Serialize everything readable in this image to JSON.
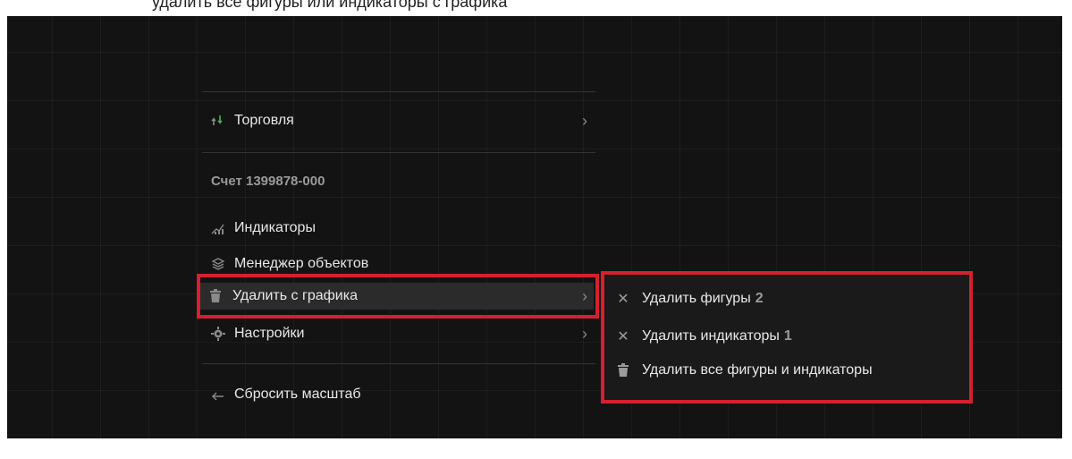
{
  "header_caption": "удалить все фигуры или индикаторы с графика",
  "menu": {
    "trade": {
      "label": "Торговля",
      "chevron": "›",
      "icon": "trade-arrows-icon"
    },
    "account_title": "Счет 1399878-000",
    "indicators": {
      "label": "Индикаторы",
      "icon": "indicators-chart-icon"
    },
    "object_manager": {
      "label": "Менеджер объектов",
      "icon": "layers-icon"
    },
    "remove_from_chart": {
      "label": "Удалить с графика",
      "chevron": "›",
      "icon": "trash-icon"
    },
    "settings": {
      "label": "Настройки",
      "chevron": "›",
      "icon": "gear-icon"
    },
    "reset_scale": {
      "label": "Сбросить масштаб",
      "icon": "back-arrow-icon"
    }
  },
  "submenu": {
    "remove_figures": {
      "label": "Удалить фигуры",
      "count": "2",
      "icon": "close-x-icon"
    },
    "remove_indicators": {
      "label": "Удалить индикаторы",
      "count": "1",
      "icon": "close-x-icon"
    },
    "remove_all": {
      "label": "Удалить все фигуры и индикаторы",
      "icon": "trash-icon"
    }
  },
  "colors": {
    "background": "#131313",
    "highlight_border": "#d42030",
    "text": "#e8e8e8",
    "muted": "#9a9a9a"
  }
}
